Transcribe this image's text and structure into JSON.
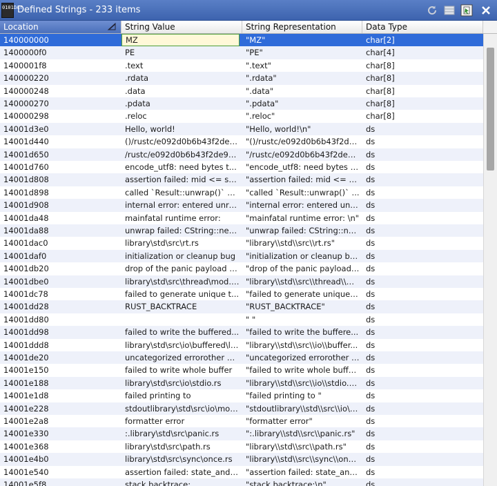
{
  "window": {
    "title": "Defined Strings - 233 items",
    "app_icon_text": "0101DAT"
  },
  "toolbar": {
    "icons": [
      "refresh-icon",
      "table-view-icon",
      "select-data-icon",
      "close-icon"
    ]
  },
  "columns": [
    "Location",
    "String Value",
    "String Representation",
    "Data Type"
  ],
  "rows": [
    {
      "loc": "140000000",
      "val": "MZ",
      "rep": "\"MZ\"",
      "type": "char[2]"
    },
    {
      "loc": "1400000f0",
      "val": "PE",
      "rep": "\"PE\"",
      "type": "char[4]"
    },
    {
      "loc": "1400001f8",
      "val": ".text",
      "rep": "\".text\"",
      "type": "char[8]"
    },
    {
      "loc": "140000220",
      "val": ".rdata",
      "rep": "\".rdata\"",
      "type": "char[8]"
    },
    {
      "loc": "140000248",
      "val": ".data",
      "rep": "\".data\"",
      "type": "char[8]"
    },
    {
      "loc": "140000270",
      "val": ".pdata",
      "rep": "\".pdata\"",
      "type": "char[8]"
    },
    {
      "loc": "140000298",
      "val": ".reloc",
      "rep": "\".reloc\"",
      "type": "char[8]"
    },
    {
      "loc": "14001d3e0",
      "val": "Hello, world!",
      "rep": "\"Hello, world!\\n\"",
      "type": "ds"
    },
    {
      "loc": "14001d440",
      "val": "()/rustc/e092d0b6b43f2de96...",
      "rep": "\"()/rustc/e092d0b6b43f2de9...",
      "type": "ds"
    },
    {
      "loc": "14001d650",
      "val": "/rustc/e092d0b6b43f2de967...",
      "rep": "\"/rustc/e092d0b6b43f2de96...",
      "type": "ds"
    },
    {
      "loc": "14001d760",
      "val": "encode_utf8: need bytes t...",
      "rep": "\"encode_utf8: need bytes t...",
      "type": "ds"
    },
    {
      "loc": "14001d808",
      "val": "assertion failed: mid <= se...",
      "rep": "\"assertion failed: mid <= s...",
      "type": "ds"
    },
    {
      "loc": "14001d898",
      "val": "called `Result::unwrap()` o...",
      "rep": "\"called `Result::unwrap()` ...",
      "type": "ds"
    },
    {
      "loc": "14001d908",
      "val": "internal error: entered unre...",
      "rep": "\"internal error: entered unr...",
      "type": "ds"
    },
    {
      "loc": "14001da48",
      "val": "mainfatal runtime error:",
      "rep": "\"mainfatal runtime error: \\n\"",
      "type": "ds"
    },
    {
      "loc": "14001da88",
      "val": "unwrap failed: CString::new...",
      "rep": "\"unwrap failed: CString::ne...",
      "type": "ds"
    },
    {
      "loc": "14001dac0",
      "val": "library\\std\\src\\rt.rs",
      "rep": "\"library\\\\std\\\\src\\\\rt.rs\"",
      "type": "ds"
    },
    {
      "loc": "14001daf0",
      "val": "initialization or cleanup bug",
      "rep": "\"initialization or cleanup bug\"",
      "type": "ds"
    },
    {
      "loc": "14001db20",
      "val": "drop of the panic payload p...",
      "rep": "\"drop of the panic payload ...",
      "type": "ds"
    },
    {
      "loc": "14001dbe0",
      "val": "library\\std\\src\\thread\\mod.r...",
      "rep": "\"library\\\\std\\\\src\\\\thread\\\\m...",
      "type": "ds"
    },
    {
      "loc": "14001dc78",
      "val": "failed to generate unique t...",
      "rep": "\"failed to generate unique t...",
      "type": "ds"
    },
    {
      "loc": "14001dd28",
      "val": "RUST_BACKTRACE",
      "rep": "\"RUST_BACKTRACE\"",
      "type": "ds"
    },
    {
      "loc": "14001dd80",
      "val": "",
      "rep": "\"      \"",
      "type": "ds"
    },
    {
      "loc": "14001dd98",
      "val": "failed to write the buffered...",
      "rep": "\"failed to write the buffere...",
      "type": "ds"
    },
    {
      "loc": "14001ddd8",
      "val": "library\\std\\src\\io\\buffered\\li...",
      "rep": "\"library\\\\std\\\\src\\\\io\\\\buffer...",
      "type": "ds"
    },
    {
      "loc": "14001de20",
      "val": "uncategorized errorother er...",
      "rep": "\"uncategorized errorother e...",
      "type": "ds"
    },
    {
      "loc": "14001e150",
      "val": "failed to write whole buffer",
      "rep": "\"failed to write whole buffer\"",
      "type": "ds"
    },
    {
      "loc": "14001e188",
      "val": "library\\std\\src\\io\\stdio.rs",
      "rep": "\"library\\\\std\\\\src\\\\io\\\\stdio.rs\"",
      "type": "ds"
    },
    {
      "loc": "14001e1d8",
      "val": "failed printing to",
      "rep": "\"failed printing to \"",
      "type": "ds"
    },
    {
      "loc": "14001e228",
      "val": "stdoutlibrary\\std\\src\\io\\mod.rs",
      "rep": "\"stdoutlibrary\\\\std\\\\src\\\\io\\\\...",
      "type": "ds"
    },
    {
      "loc": "14001e2a8",
      "val": "formatter error",
      "rep": "\"formatter error\"",
      "type": "ds"
    },
    {
      "loc": "14001e330",
      "val": ":.library\\std\\src\\panic.rs",
      "rep": "\":.library\\\\std\\\\src\\\\panic.rs\"",
      "type": "ds"
    },
    {
      "loc": "14001e368",
      "val": "library\\std\\src\\path.rs",
      "rep": "\"library\\\\std\\\\src\\\\path.rs\"",
      "type": "ds"
    },
    {
      "loc": "14001e4b0",
      "val": "library\\std\\src\\sync\\once.rs",
      "rep": "\"library\\\\std\\\\src\\\\sync\\\\onc...",
      "type": "ds"
    },
    {
      "loc": "14001e540",
      "val": "assertion failed: state_and_...",
      "rep": "\"assertion failed: state_and...",
      "type": "ds"
    },
    {
      "loc": "14001e5f8",
      "val": "stack backtrace:",
      "rep": "\"stack backtrace:\\n\"",
      "type": "ds"
    }
  ],
  "selected_row": 0,
  "colors": {
    "titlebar": "#3d63ae",
    "selection": "#2f6bd9",
    "alt_row": "#eef1fa"
  }
}
